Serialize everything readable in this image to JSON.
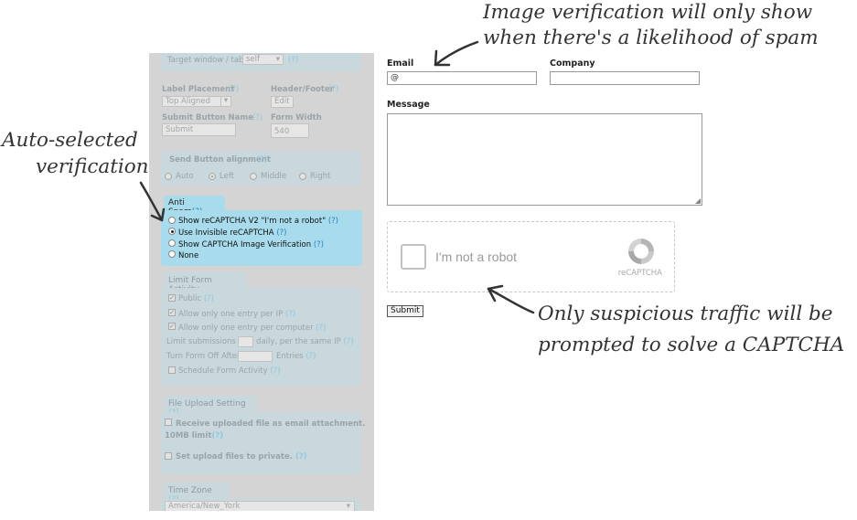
{
  "settings": {
    "target_window_label": "Target window / tab:",
    "target_window_value": "self",
    "help": "(?)",
    "label_placement_label": "Label Placement",
    "label_placement_value": "Top Aligned",
    "header_footer_label": "Header/Footer",
    "edit_label": "Edit",
    "submit_button_name_label": "Submit Button Name",
    "submit_button_name_value": "Submit",
    "form_width_label": "Form Width",
    "form_width_value": "540",
    "send_alignment_label": "Send Button alignment",
    "alignment_options": [
      "Auto",
      "Left",
      "Middle",
      "Right"
    ],
    "alignment_selected": "Left",
    "anti_spam": {
      "header": "Anti Spam",
      "options": [
        "Show reCAPTCHA V2 \"I'm not a robot\"",
        "Use Invisible reCAPTCHA",
        "Show CAPTCHA Image Verification",
        "None"
      ],
      "selected": "Use Invisible reCAPTCHA"
    },
    "limit_activity": {
      "header": "Limit Form Activity",
      "public": "Public",
      "one_per_ip": "Allow only one entry per IP",
      "one_per_computer": "Allow only one entry per computer",
      "limit_submissions_pre": "Limit submissions to",
      "limit_submissions_post": "daily, per the same IP",
      "turn_off_pre": "Turn Form Off After",
      "turn_off_post": "Entries",
      "schedule": "Schedule Form Activity"
    },
    "file_upload": {
      "header": "File Upload Setting",
      "attach_line1": "Receive uploaded file as email attachment.",
      "attach_line2": "10MB limit",
      "private": "Set upload files to private."
    },
    "time_zone": {
      "header": "Time Zone",
      "value": "America/New_York"
    }
  },
  "form": {
    "email_label": "Email",
    "email_value": "@",
    "company_label": "Company",
    "company_value": "",
    "message_label": "Message",
    "message_value": "",
    "captcha_text": "I'm not a robot",
    "captcha_brand": "reCAPTCHA",
    "submit_label": "Submit"
  },
  "annotations": {
    "top_line1": "Image verification will only show",
    "top_line2": "when there's a likelihood of spam",
    "left_line1": "Auto-selected",
    "left_line2": "verification",
    "bottom_line1": "Only suspicious traffic will be",
    "bottom_line2": "prompted to solve a CAPTCHA"
  }
}
